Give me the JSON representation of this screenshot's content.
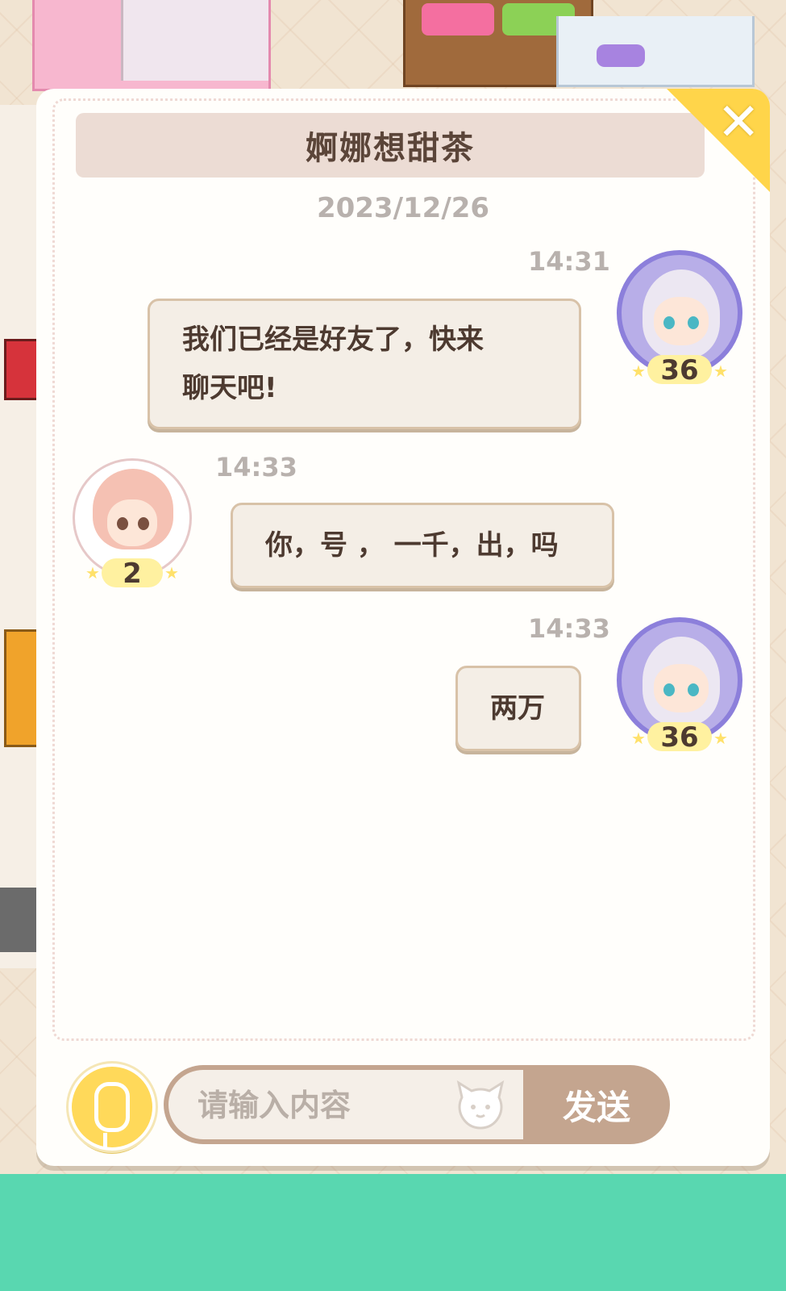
{
  "dialog": {
    "title": "婀娜想甜茶",
    "date": "2023/12/26",
    "close_icon": "close-icon"
  },
  "messages": [
    {
      "side": "right",
      "time": "14:31",
      "text": "我们已经是好友了，快来\n聊天吧!",
      "level": "36",
      "avatar": "silver-hair-girl-avatar"
    },
    {
      "side": "left",
      "time": "14:33",
      "text": "你，号 ， 一千，出，吗",
      "level": "2",
      "avatar": "pink-hair-boy-avatar"
    },
    {
      "side": "right",
      "time": "14:33",
      "text": "两万",
      "level": "36",
      "avatar": "silver-hair-girl-avatar"
    }
  ],
  "input": {
    "placeholder": "请输入内容",
    "send_label": "发送",
    "mic_icon": "microphone-icon",
    "sticker_icon": "cat-sticker-icon"
  },
  "colors": {
    "accent": "#c4a58f",
    "mic": "#ffd95a",
    "close": "#ffd54a",
    "ground": "#59d7b0"
  }
}
